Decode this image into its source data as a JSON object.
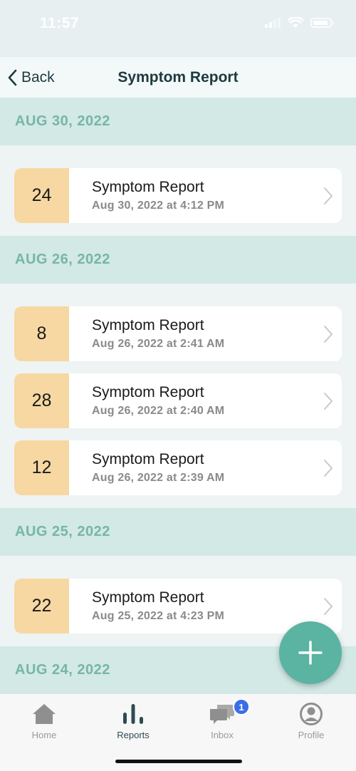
{
  "status_bar": {
    "time": "11:57"
  },
  "nav": {
    "back_label": "Back",
    "title": "Symptom Report"
  },
  "sections": [
    {
      "date": "AUG 30, 2022",
      "reports": [
        {
          "score": "24",
          "title": "Symptom Report",
          "timestamp": "Aug 30, 2022 at 4:12 PM"
        }
      ]
    },
    {
      "date": "AUG 26, 2022",
      "reports": [
        {
          "score": "8",
          "title": "Symptom Report",
          "timestamp": "Aug 26, 2022 at 2:41 AM"
        },
        {
          "score": "28",
          "title": "Symptom Report",
          "timestamp": "Aug 26, 2022 at 2:40 AM"
        },
        {
          "score": "12",
          "title": "Symptom Report",
          "timestamp": "Aug 26, 2022 at 2:39 AM"
        }
      ]
    },
    {
      "date": "AUG 25, 2022",
      "reports": [
        {
          "score": "22",
          "title": "Symptom Report",
          "timestamp": "Aug 25, 2022 at 4:23 PM"
        }
      ]
    },
    {
      "date": "AUG 24, 2022",
      "reports": []
    }
  ],
  "tabs": [
    {
      "label": "Home",
      "icon": "home-icon",
      "active": false
    },
    {
      "label": "Reports",
      "icon": "bar-chart-icon",
      "active": true
    },
    {
      "label": "Inbox",
      "icon": "chat-bubbles-icon",
      "active": false,
      "badge": "1"
    },
    {
      "label": "Profile",
      "icon": "user-circle-icon",
      "active": false
    }
  ],
  "colors": {
    "section_header_bg": "#d2e9e5",
    "section_header_text": "#77b5a8",
    "score_bg": "#f7d8a2",
    "fab_bg": "#5bb3a1",
    "badge_bg": "#3a6ee8"
  },
  "fab": {
    "icon": "plus-icon"
  }
}
